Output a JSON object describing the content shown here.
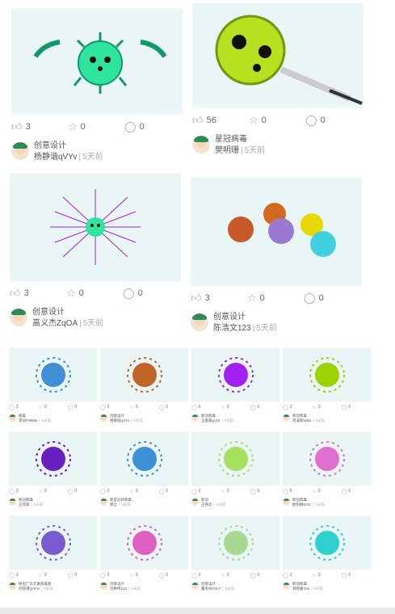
{
  "large_cards": [
    {
      "title": "",
      "category": "创意设计",
      "author": "杨静谐qVYv",
      "time": "5天前",
      "likes": "3",
      "favorites": "0",
      "comments": "0"
    },
    {
      "title": "星冠病毒",
      "category": "",
      "author": "樊明珊",
      "time": "5天前",
      "likes": "56",
      "favorites": "0",
      "comments": "0"
    },
    {
      "title": "",
      "category": "创意设计",
      "author": "高义杰ZqOA",
      "time": "5天前",
      "likes": "3",
      "favorites": "0",
      "comments": "0"
    },
    {
      "title": "",
      "category": "创意设计",
      "author": "陈浩文123",
      "time": "5天前",
      "likes": "3",
      "favorites": "0",
      "comments": "0"
    }
  ],
  "small_cards": [
    {
      "category": "病毒",
      "author": "李冠FWbbk",
      "time": "5天前",
      "likes": "2",
      "favorites": "0",
      "comments": "0"
    },
    {
      "category": "创意设计",
      "author": "杨静谐qVYv",
      "time": "5天前",
      "likes": "2",
      "favorites": "0",
      "comments": "0"
    },
    {
      "category": "新冠病毒",
      "author": "王俊豪go16",
      "time": "5天前",
      "likes": "6",
      "favorites": "0",
      "comments": "0"
    },
    {
      "category": "新冠病毒",
      "author": "周溪斯bdkn",
      "time": "5天前",
      "likes": "2",
      "favorites": "0",
      "comments": "0"
    },
    {
      "category": "新冠病毒",
      "author": "王欣瑜",
      "time": "5天前",
      "likes": "2",
      "favorites": "0",
      "comments": "0"
    },
    {
      "category": "新型冠状病毒",
      "author": "郝立",
      "time": "5天前",
      "likes": "2",
      "favorites": "0",
      "comments": "0"
    },
    {
      "category": "新冠",
      "author": "王燕达",
      "time": "5天前",
      "likes": "2",
      "favorites": "0",
      "comments": "0"
    },
    {
      "category": "新冠病毒",
      "author": "欧阳静EOC",
      "time": "5天前",
      "likes": "5",
      "favorites": "0",
      "comments": "0"
    },
    {
      "category": "研究广东元素病毒图",
      "author": "刘钰瑾QAFw",
      "time": "5天前",
      "likes": "3",
      "favorites": "0",
      "comments": "0"
    },
    {
      "category": "创意设计",
      "author": "刘钟伟123",
      "time": "5天前",
      "likes": "2",
      "favorites": "0",
      "comments": "0"
    },
    {
      "category": "创意设计",
      "author": "董思州OJu7",
      "time": "5天前",
      "likes": "2",
      "favorites": "0",
      "comments": "0"
    },
    {
      "category": "新冠病毒",
      "author": "领悦嘉4Vu",
      "time": "5天前",
      "likes": "2",
      "favorites": "0",
      "comments": "0"
    }
  ],
  "icons": {
    "like": "thumbs-up-icon",
    "favorite": "star-icon",
    "comment": "comment-icon"
  },
  "colors": {
    "thumb_bg": "#eaf5f5",
    "virus_green": "#2ee59d",
    "virus_purple": "#a020f0"
  }
}
